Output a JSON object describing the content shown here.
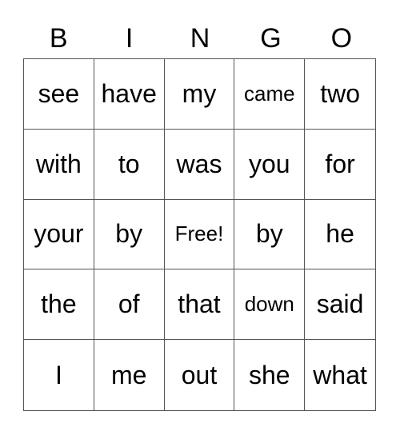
{
  "header": [
    "B",
    "I",
    "N",
    "G",
    "O"
  ],
  "cells": [
    "see",
    "have",
    "my",
    "came",
    "two",
    "with",
    "to",
    "was",
    "you",
    "for",
    "your",
    "by",
    "Free!",
    "by",
    "he",
    "the",
    "of",
    "that",
    "down",
    "said",
    "I",
    "me",
    "out",
    "she",
    "what"
  ]
}
